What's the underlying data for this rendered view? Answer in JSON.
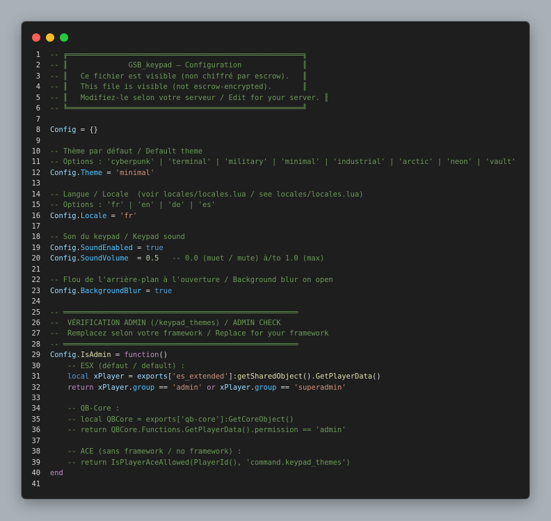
{
  "window": {
    "controls": [
      "close",
      "minimize",
      "maximize"
    ],
    "colors": {
      "close": "#ff5f56",
      "minimize": "#ffbd2e",
      "maximize": "#27c93f",
      "background": "#1e1e1e"
    }
  },
  "editor": {
    "language": "lua",
    "line_numbers": [
      "1",
      "2",
      "3",
      "4",
      "5",
      "6",
      "7",
      "8",
      "9",
      "10",
      "11",
      "12",
      "13",
      "14",
      "15",
      "16",
      "17",
      "18",
      "19",
      "20",
      "21",
      "22",
      "23",
      "24",
      "25",
      "26",
      "27",
      "28",
      "29",
      "30",
      "31",
      "32",
      "33",
      "34",
      "35",
      "36",
      "37",
      "38",
      "39",
      "40",
      "41"
    ],
    "lines": [
      [
        {
          "t": "c",
          "v": "-- ╔══════════════════════════════════════════════════════╗"
        }
      ],
      [
        {
          "t": "c",
          "v": "-- ║              GSB_keypad — Configuration              ║"
        }
      ],
      [
        {
          "t": "c",
          "v": "-- ║   Ce fichier est visible (non chiffré par escrow).   ║"
        }
      ],
      [
        {
          "t": "c",
          "v": "-- ║   This file is visible (not escrow-encrypted).       ║"
        }
      ],
      [
        {
          "t": "c",
          "v": "-- ║   Modifiez-le selon votre serveur / Edit for your server. ║"
        }
      ],
      [
        {
          "t": "c",
          "v": "-- ╚══════════════════════════════════════════════════════╝"
        }
      ],
      [],
      [
        {
          "t": "v",
          "v": "Config"
        },
        {
          "t": "p",
          "v": " = {}"
        }
      ],
      [],
      [
        {
          "t": "c",
          "v": "-- Thème par défaut / Default theme"
        }
      ],
      [
        {
          "t": "c",
          "v": "-- Options : 'cyberpunk' | 'terminal' | 'military' | 'minimal' | 'industrial' | 'arctic' | 'neon' | 'vault'"
        }
      ],
      [
        {
          "t": "v",
          "v": "Config"
        },
        {
          "t": "p",
          "v": "."
        },
        {
          "t": "fld",
          "v": "Theme"
        },
        {
          "t": "p",
          "v": " = "
        },
        {
          "t": "s",
          "v": "'minimal'"
        }
      ],
      [],
      [
        {
          "t": "c",
          "v": "-- Langue / Locale  (voir locales/locales.lua / see locales/locales.lua)"
        }
      ],
      [
        {
          "t": "c",
          "v": "-- Options : 'fr' | 'en' | 'de' | 'es'"
        }
      ],
      [
        {
          "t": "v",
          "v": "Config"
        },
        {
          "t": "p",
          "v": "."
        },
        {
          "t": "fld",
          "v": "Locale"
        },
        {
          "t": "p",
          "v": " = "
        },
        {
          "t": "s",
          "v": "'fr'"
        }
      ],
      [],
      [
        {
          "t": "c",
          "v": "-- Son du keypad / Keypad sound"
        }
      ],
      [
        {
          "t": "v",
          "v": "Config"
        },
        {
          "t": "p",
          "v": "."
        },
        {
          "t": "fld",
          "v": "SoundEnabled"
        },
        {
          "t": "p",
          "v": " = "
        },
        {
          "t": "b",
          "v": "true"
        }
      ],
      [
        {
          "t": "v",
          "v": "Config"
        },
        {
          "t": "p",
          "v": "."
        },
        {
          "t": "fld",
          "v": "SoundVolume"
        },
        {
          "t": "p",
          "v": "  = "
        },
        {
          "t": "n",
          "v": "0.5"
        },
        {
          "t": "p",
          "v": "   "
        },
        {
          "t": "c",
          "v": "-- 0.0 (muet / mute) à/to 1.0 (max)"
        }
      ],
      [],
      [
        {
          "t": "c",
          "v": "-- Flou de l'arrière-plan à l'ouverture / Background blur on open"
        }
      ],
      [
        {
          "t": "v",
          "v": "Config"
        },
        {
          "t": "p",
          "v": "."
        },
        {
          "t": "fld",
          "v": "BackgroundBlur"
        },
        {
          "t": "p",
          "v": " = "
        },
        {
          "t": "b",
          "v": "true"
        }
      ],
      [],
      [
        {
          "t": "c",
          "v": "-- ══════════════════════════════════════════════════════"
        }
      ],
      [
        {
          "t": "c",
          "v": "--  VÉRIFICATION ADMIN (/keypad_themes) / ADMIN CHECK"
        }
      ],
      [
        {
          "t": "c",
          "v": "--  Remplacez selon votre framework / Replace for your framework"
        }
      ],
      [
        {
          "t": "c",
          "v": "-- ══════════════════════════════════════════════════════"
        }
      ],
      [
        {
          "t": "v",
          "v": "Config"
        },
        {
          "t": "p",
          "v": "."
        },
        {
          "t": "f",
          "v": "IsAdmin"
        },
        {
          "t": "p",
          "v": " = "
        },
        {
          "t": "k",
          "v": "function"
        },
        {
          "t": "p",
          "v": "()"
        }
      ],
      [
        {
          "t": "p",
          "v": "    "
        },
        {
          "t": "c",
          "v": "-- ESX (défaut / default) :"
        }
      ],
      [
        {
          "t": "p",
          "v": "    "
        },
        {
          "t": "b",
          "v": "local"
        },
        {
          "t": "p",
          "v": " "
        },
        {
          "t": "v",
          "v": "xPlayer"
        },
        {
          "t": "p",
          "v": " = "
        },
        {
          "t": "v",
          "v": "exports"
        },
        {
          "t": "p",
          "v": "["
        },
        {
          "t": "s",
          "v": "'es_extended'"
        },
        {
          "t": "p",
          "v": "]:"
        },
        {
          "t": "f",
          "v": "getSharedObject"
        },
        {
          "t": "p",
          "v": "()."
        },
        {
          "t": "f",
          "v": "GetPlayerData"
        },
        {
          "t": "p",
          "v": "()"
        }
      ],
      [
        {
          "t": "p",
          "v": "    "
        },
        {
          "t": "k",
          "v": "return"
        },
        {
          "t": "p",
          "v": " "
        },
        {
          "t": "v",
          "v": "xPlayer"
        },
        {
          "t": "p",
          "v": "."
        },
        {
          "t": "fld",
          "v": "group"
        },
        {
          "t": "p",
          "v": " == "
        },
        {
          "t": "s",
          "v": "'admin'"
        },
        {
          "t": "p",
          "v": " "
        },
        {
          "t": "k",
          "v": "or"
        },
        {
          "t": "p",
          "v": " "
        },
        {
          "t": "v",
          "v": "xPlayer"
        },
        {
          "t": "p",
          "v": "."
        },
        {
          "t": "fld",
          "v": "group"
        },
        {
          "t": "p",
          "v": " == "
        },
        {
          "t": "s",
          "v": "'superadmin'"
        }
      ],
      [],
      [
        {
          "t": "p",
          "v": "    "
        },
        {
          "t": "c",
          "v": "-- QB-Core :"
        }
      ],
      [
        {
          "t": "p",
          "v": "    "
        },
        {
          "t": "c",
          "v": "-- local QBCore = exports['qb-core']:GetCoreObject()"
        }
      ],
      [
        {
          "t": "p",
          "v": "    "
        },
        {
          "t": "c",
          "v": "-- return QBCore.Functions.GetPlayerData().permission == 'admin'"
        }
      ],
      [],
      [
        {
          "t": "p",
          "v": "    "
        },
        {
          "t": "c",
          "v": "-- ACE (sans framework / no framework) :"
        }
      ],
      [
        {
          "t": "p",
          "v": "    "
        },
        {
          "t": "c",
          "v": "-- return IsPlayerAceAllowed(PlayerId(), 'command.keypad_themes')"
        }
      ],
      [
        {
          "t": "k",
          "v": "end"
        }
      ],
      []
    ]
  }
}
